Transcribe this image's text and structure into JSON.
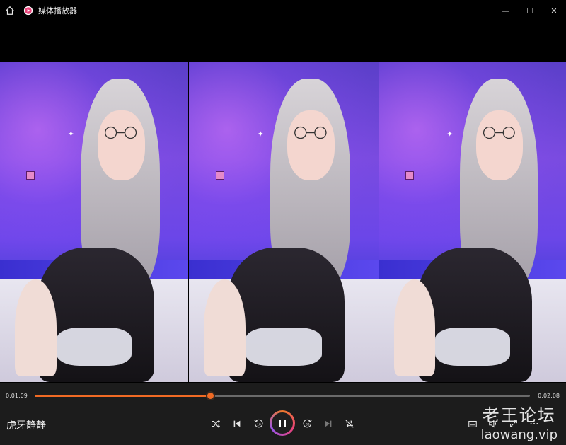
{
  "titlebar": {
    "title": "媒体播放器",
    "minimize": "—",
    "maximize": "☐",
    "close": "✕"
  },
  "player": {
    "current_time": "0:01:09",
    "total_time": "0:02:08",
    "progress_fraction": 0.354,
    "track_title": "虎牙静静"
  },
  "watermark": {
    "chinese": "老王论坛",
    "url": "laowang.vip"
  },
  "accent_color": "#f06a24"
}
